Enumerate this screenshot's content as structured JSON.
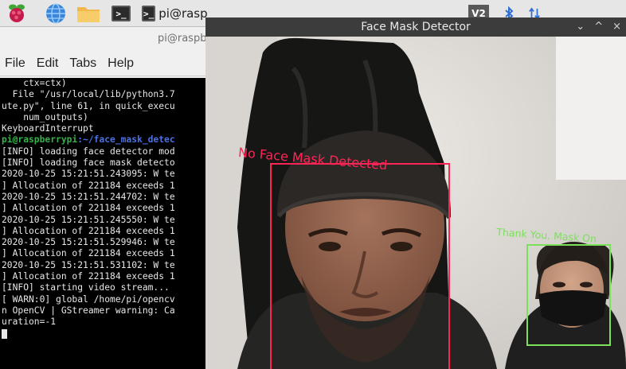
{
  "taskbar": {
    "apps": [
      "raspberry-menu",
      "web-browser",
      "file-manager",
      "terminal"
    ],
    "active_task": "pi@rasp",
    "tray_label": "V2"
  },
  "terminal": {
    "title": "pi@raspb",
    "menu": [
      "File",
      "Edit",
      "Tabs",
      "Help"
    ],
    "lines": [
      {
        "text": "    ctx=ctx)",
        "type": "normal"
      },
      {
        "text": "  File \"/usr/local/lib/python3.7",
        "type": "normal"
      },
      {
        "text": "ute.py\", line 61, in quick_execu",
        "type": "normal"
      },
      {
        "text": "    num_outputs)",
        "type": "normal"
      },
      {
        "text": "KeyboardInterrupt",
        "type": "normal"
      },
      {
        "user": "pi@raspberrypi",
        "path": ":~/face_mask_detec",
        "type": "prompt"
      },
      {
        "text": "[INFO] loading face detector mod",
        "type": "normal"
      },
      {
        "text": "[INFO] loading face mask detecto",
        "type": "normal"
      },
      {
        "text": "2020-10-25 15:21:51.243095: W te",
        "type": "normal"
      },
      {
        "text": "] Allocation of 221184 exceeds 1",
        "type": "normal"
      },
      {
        "text": "2020-10-25 15:21:51.244702: W te",
        "type": "normal"
      },
      {
        "text": "] Allocation of 221184 exceeds 1",
        "type": "normal"
      },
      {
        "text": "2020-10-25 15:21:51.245550: W te",
        "type": "normal"
      },
      {
        "text": "] Allocation of 221184 exceeds 1",
        "type": "normal"
      },
      {
        "text": "2020-10-25 15:21:51.529946: W te",
        "type": "normal"
      },
      {
        "text": "] Allocation of 221184 exceeds 1",
        "type": "normal"
      },
      {
        "text": "2020-10-25 15:21:51.531102: W te",
        "type": "normal"
      },
      {
        "text": "] Allocation of 221184 exceeds 1",
        "type": "normal"
      },
      {
        "text": "[INFO] starting video stream...",
        "type": "normal"
      },
      {
        "text": "[ WARN:0] global /home/pi/opencv",
        "type": "normal"
      },
      {
        "text": "n OpenCV | GStreamer warning: Ca",
        "type": "normal"
      },
      {
        "text": "uration=-1",
        "type": "normal"
      }
    ]
  },
  "detector": {
    "title": "Face Mask Detector",
    "controls": [
      "⌄",
      "^",
      "×"
    ],
    "detections": [
      {
        "label": "No Face Mask Detected",
        "color": "#ff2456"
      },
      {
        "label": "Thank You. Mask On",
        "color": "#7be05a"
      }
    ]
  }
}
